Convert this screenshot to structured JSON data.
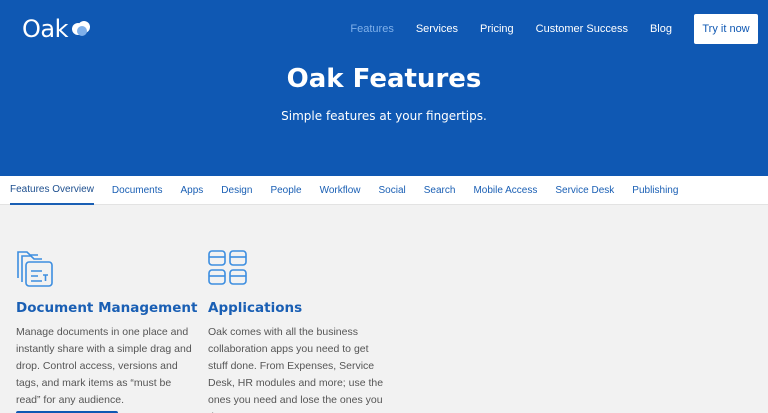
{
  "brand": {
    "name": "Oak"
  },
  "nav": {
    "items": [
      {
        "label": "Features",
        "active": true
      },
      {
        "label": "Services",
        "active": false
      },
      {
        "label": "Pricing",
        "active": false
      },
      {
        "label": "Customer Success",
        "active": false
      },
      {
        "label": "Blog",
        "active": false
      }
    ],
    "cta": "Try it now"
  },
  "hero": {
    "title": "Oak Features",
    "subtitle": "Simple features at your fingertips."
  },
  "tabs": [
    {
      "label": "Features Overview",
      "active": true
    },
    {
      "label": "Documents"
    },
    {
      "label": "Apps"
    },
    {
      "label": "Design"
    },
    {
      "label": "People"
    },
    {
      "label": "Workflow"
    },
    {
      "label": "Social"
    },
    {
      "label": "Search"
    },
    {
      "label": "Mobile Access"
    },
    {
      "label": "Service Desk"
    },
    {
      "label": "Publishing"
    }
  ],
  "cards": [
    {
      "icon": "documents-icon",
      "title": "Document Management",
      "body": "Manage documents in one place and instantly share with a simple drag and drop. Control access, versions and tags, and mark items as “must be read” for any audience."
    },
    {
      "icon": "apps-grid-icon",
      "title": "Applications",
      "body": "Oak comes with all the business collaboration apps you need to get stuff done. From Expenses, Service Desk, HR modules and more; use the ones you need and lose the ones you don't."
    }
  ],
  "colors": {
    "brand_blue": "#0f58b3",
    "link_blue": "#1a5fb4",
    "active_nav": "#7fb0ea"
  }
}
